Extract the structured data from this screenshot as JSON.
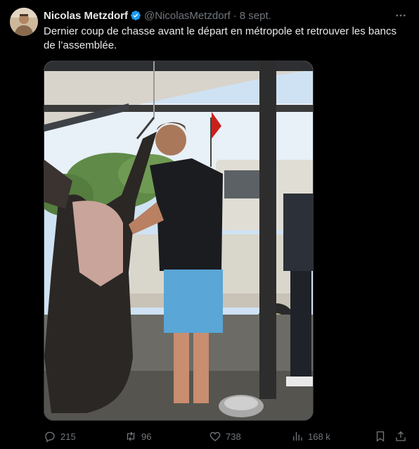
{
  "author": {
    "name": "Nicolas Metzdorf",
    "handle": "@NicolasMetzdorf",
    "separator": "·",
    "date": "8 sept."
  },
  "tweet": {
    "text": "Dernier coup de chasse avant le départ en métropole et retrouver les bancs de l’assemblée."
  },
  "metrics": {
    "replies": "215",
    "reposts": "96",
    "likes": "738",
    "views": "168 k"
  },
  "icons": {
    "verified": "verified-badge-icon",
    "more": "more-dots-icon",
    "reply": "reply-icon",
    "repost": "repost-icon",
    "like": "heart-icon",
    "views": "views-bar-icon",
    "bookmark": "bookmark-icon",
    "share": "share-icon"
  },
  "colors": {
    "background": "#000000",
    "text": "#e7e9ea",
    "muted": "#71767b",
    "verified": "#1d9bf0",
    "border": "#2f3336"
  }
}
